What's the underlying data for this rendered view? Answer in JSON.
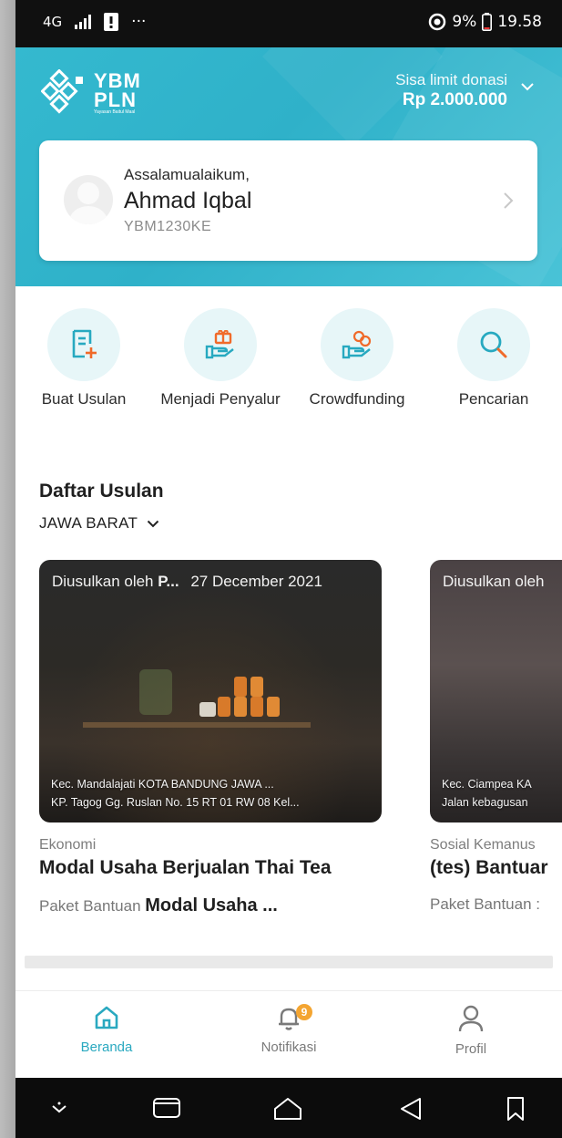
{
  "status_bar": {
    "network": "4G",
    "battery_pct": "9%",
    "time": "19.58",
    "more": "···"
  },
  "header": {
    "logo_line1": "YBM",
    "logo_line2": "PLN",
    "logo_sub": "Yayasan Baitul Maal",
    "limit_label": "Sisa limit donasi",
    "limit_value": "Rp 2.000.000"
  },
  "user": {
    "greeting": "Assalamualaikum,",
    "name": "Ahmad Iqbal",
    "code": "YBM1230KE"
  },
  "menu": [
    {
      "label": "Buat Usulan",
      "icon": "document-add-icon"
    },
    {
      "label": "Menjadi Penyalur",
      "icon": "hand-gift-icon"
    },
    {
      "label": "Crowdfunding",
      "icon": "hand-coins-icon"
    },
    {
      "label": "Pencarian",
      "icon": "search-icon"
    }
  ],
  "section": {
    "title": "Daftar Usulan",
    "region": "JAWA BARAT"
  },
  "proposals": [
    {
      "proposed_by": "Diusulkan oleh",
      "proposer": "P...",
      "date": "27 December 2021",
      "address1": "Kec. Mandalajati KOTA BANDUNG JAWA ...",
      "address2": "KP. Tagog Gg. Ruslan No. 15 RT 01 RW 08 Kel...",
      "category": "Ekonomi",
      "title": "Modal Usaha Berjualan Thai Tea",
      "package_label": "Paket Bantuan",
      "package_value": "Modal Usaha ..."
    },
    {
      "proposed_by": "Diusulkan oleh",
      "proposer": "",
      "date": "",
      "address1": "Kec. Ciampea KA",
      "address2": "Jalan kebagusan",
      "category": "Sosial Kemanus",
      "title": "(tes) Bantuar",
      "package_label": "Paket Bantuan :",
      "package_value": ""
    }
  ],
  "bottom_nav": [
    {
      "label": "Beranda",
      "icon": "home-icon",
      "active": true
    },
    {
      "label": "Notifikasi",
      "icon": "bell-icon",
      "badge": "9"
    },
    {
      "label": "Profil",
      "icon": "user-icon"
    }
  ],
  "colors": {
    "accent": "#2fb1c9",
    "badge": "#f4a531"
  }
}
